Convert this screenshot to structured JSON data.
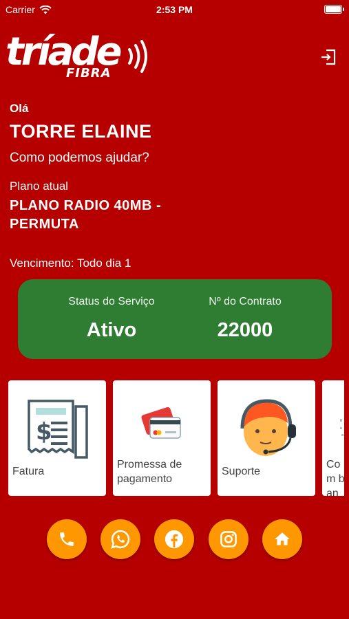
{
  "status_bar": {
    "carrier": "Carrier",
    "time": "2:53 PM"
  },
  "brand": {
    "name": "tríade",
    "sub": "FIBRA"
  },
  "header": {
    "logout_icon": "logout-icon"
  },
  "user": {
    "greeting": "Olá",
    "name": "TORRE ELAINE",
    "help_text": "Como podemos ajudar?",
    "plan_label": "Plano atual",
    "plan_name": "PLANO RADIO 40MB - PERMUTA",
    "due_text": "Vencimento: Todo dia 1"
  },
  "service": {
    "status_label": "Status do Serviço",
    "status_value": "Ativo",
    "contract_label": "Nº do Contrato",
    "contract_value": "22000"
  },
  "menu": [
    {
      "label": "Fatura",
      "icon": "invoice-icon"
    },
    {
      "label": "Promessa de pagamento",
      "icon": "credit-card-icon"
    },
    {
      "label": "Suporte",
      "icon": "support-agent-icon"
    },
    {
      "label": "Com ban",
      "icon": "bank-icon"
    }
  ],
  "socials": [
    {
      "name": "phone",
      "icon": "phone-icon"
    },
    {
      "name": "whatsapp",
      "icon": "whatsapp-icon"
    },
    {
      "name": "facebook",
      "icon": "facebook-icon"
    },
    {
      "name": "instagram",
      "icon": "instagram-icon"
    },
    {
      "name": "home",
      "icon": "home-icon"
    }
  ],
  "colors": {
    "background": "#b60000",
    "status_card": "#2e7d32",
    "social_button": "#ff9800",
    "card": "#ffffff"
  }
}
